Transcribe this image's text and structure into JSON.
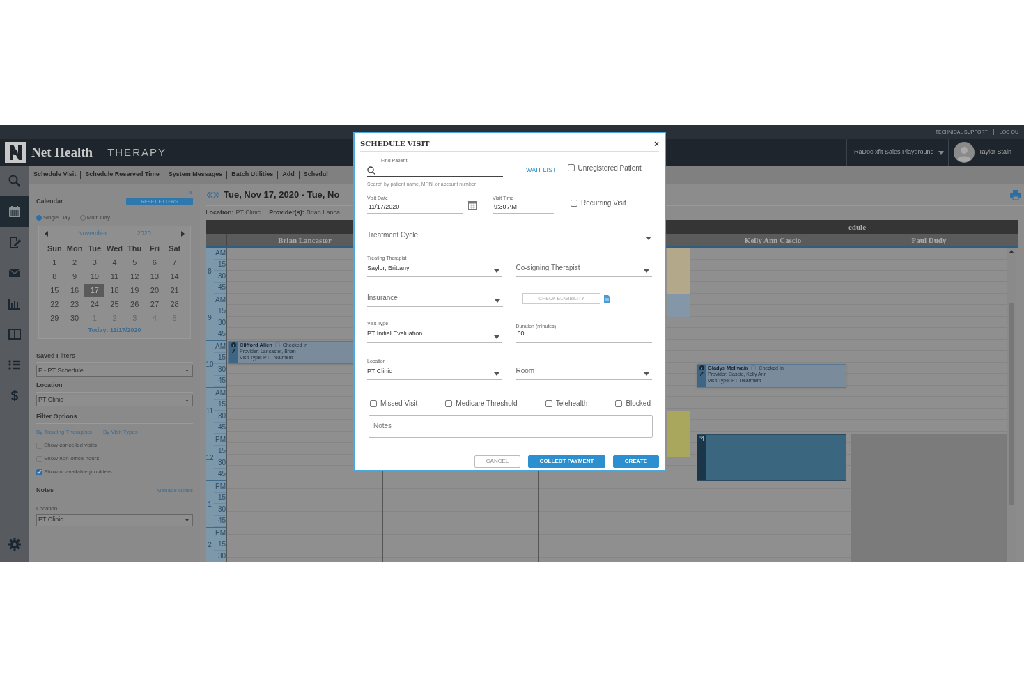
{
  "top_bar": {
    "links": [
      "TECHNICAL SUPPORT",
      "LOG OU"
    ]
  },
  "header": {
    "brand": "Net Health",
    "product": "THERAPY",
    "organization": "RaDoc xfit Sales Playground",
    "user": "Taylor Stain"
  },
  "rail": {
    "items": [
      {
        "kind": "search",
        "selected": false
      },
      {
        "kind": "calendar",
        "selected": true
      },
      {
        "kind": "document",
        "selected": false
      },
      {
        "kind": "mail",
        "selected": false
      },
      {
        "kind": "chart",
        "selected": false
      },
      {
        "kind": "columns",
        "selected": false
      },
      {
        "kind": "list",
        "selected": false
      },
      {
        "kind": "dollar",
        "selected": false
      }
    ],
    "bottom": {
      "kind": "settings",
      "selected": false
    }
  },
  "nav_links": [
    "Schedule Visit",
    "Schedule Reserved Time",
    "System Messages",
    "Batch Utilities",
    "Add",
    "Schedul"
  ],
  "calendar_panel": {
    "title": "Calendar",
    "reset_button": "RESET FILTERS",
    "collapse": "«",
    "modes": [
      {
        "label": "Single Day",
        "selected": true
      },
      {
        "label": "Multi Day",
        "selected": false
      }
    ],
    "month": "November",
    "year": "2020",
    "weekdays": [
      "Sun",
      "Mon",
      "Tue",
      "Wed",
      "Thu",
      "Fri",
      "Sat"
    ],
    "weeks": [
      [
        {
          "day": "1",
          "in_month": true,
          "selected": false
        },
        {
          "day": "2",
          "in_month": true,
          "selected": false
        },
        {
          "day": "3",
          "in_month": true,
          "selected": false
        },
        {
          "day": "4",
          "in_month": true,
          "selected": false
        },
        {
          "day": "5",
          "in_month": true,
          "selected": false
        },
        {
          "day": "6",
          "in_month": true,
          "selected": false
        },
        {
          "day": "7",
          "in_month": true,
          "selected": false
        }
      ],
      [
        {
          "day": "8",
          "in_month": true,
          "selected": false
        },
        {
          "day": "9",
          "in_month": true,
          "selected": false
        },
        {
          "day": "10",
          "in_month": true,
          "selected": false
        },
        {
          "day": "11",
          "in_month": true,
          "selected": false
        },
        {
          "day": "12",
          "in_month": true,
          "selected": false
        },
        {
          "day": "13",
          "in_month": true,
          "selected": false
        },
        {
          "day": "14",
          "in_month": true,
          "selected": false
        }
      ],
      [
        {
          "day": "15",
          "in_month": true,
          "selected": false
        },
        {
          "day": "16",
          "in_month": true,
          "selected": false
        },
        {
          "day": "17",
          "in_month": true,
          "selected": true
        },
        {
          "day": "18",
          "in_month": true,
          "selected": false
        },
        {
          "day": "19",
          "in_month": true,
          "selected": false
        },
        {
          "day": "20",
          "in_month": true,
          "selected": false
        },
        {
          "day": "21",
          "in_month": true,
          "selected": false
        }
      ],
      [
        {
          "day": "22",
          "in_month": true,
          "selected": false
        },
        {
          "day": "23",
          "in_month": true,
          "selected": false
        },
        {
          "day": "24",
          "in_month": true,
          "selected": false
        },
        {
          "day": "25",
          "in_month": true,
          "selected": false
        },
        {
          "day": "26",
          "in_month": true,
          "selected": false
        },
        {
          "day": "27",
          "in_month": true,
          "selected": false
        },
        {
          "day": "28",
          "in_month": true,
          "selected": false
        }
      ],
      [
        {
          "day": "29",
          "in_month": true,
          "selected": false
        },
        {
          "day": "30",
          "in_month": true,
          "selected": false
        },
        {
          "day": "1",
          "in_month": false,
          "selected": false
        },
        {
          "day": "2",
          "in_month": false,
          "selected": false
        },
        {
          "day": "3",
          "in_month": false,
          "selected": false
        },
        {
          "day": "4",
          "in_month": false,
          "selected": false
        },
        {
          "day": "5",
          "in_month": false,
          "selected": false
        }
      ]
    ],
    "today": "Today: 11/17/2020"
  },
  "saved_filters": {
    "label": "Saved Filters",
    "value": "F - PT Schedule"
  },
  "location_filter": {
    "label": "Location",
    "value": "PT Clinic"
  },
  "filter_options": {
    "title": "Filter Options",
    "links": [
      "By Treating Therapists",
      "By Visit Types"
    ],
    "checks": [
      {
        "label": "Show cancelled visits",
        "checked": false
      },
      {
        "label": "Show non-office hours",
        "checked": false
      },
      {
        "label": "Show unavailable providers",
        "checked": true
      }
    ]
  },
  "notes": {
    "title": "Notes",
    "link": "Manage Notes",
    "location_label": "Location",
    "location_value": "PT Clinic"
  },
  "schedule": {
    "title": "Tue, Nov 17, 2020 - Tue, No",
    "location_label": "Location:",
    "location": "PT Clinic",
    "providers_label": "Provider(s):",
    "providers": "Brian Lanca",
    "banner": "edule",
    "hours": [
      {
        "hour": "8",
        "labels": [
          "AM",
          "15",
          "30",
          "45"
        ]
      },
      {
        "hour": "9",
        "labels": [
          "AM",
          "15",
          "30",
          "45"
        ]
      },
      {
        "hour": "10",
        "labels": [
          "AM",
          "15",
          "30",
          "45"
        ]
      },
      {
        "hour": "11",
        "labels": [
          "AM",
          "15",
          "30",
          "45"
        ]
      },
      {
        "hour": "12",
        "labels": [
          "PM",
          "15",
          "30",
          "45"
        ]
      },
      {
        "hour": "1",
        "labels": [
          "PM",
          "15",
          "30",
          "45"
        ]
      },
      {
        "hour": "2",
        "labels": [
          "PM",
          "15",
          "30"
        ]
      }
    ],
    "columns": [
      {
        "name": "Brian Lancaster",
        "appointments": [
          {
            "kind": "visit",
            "patient": "Clifford Allen",
            "checked_in": false,
            "status": "Checked In",
            "provider": "Provider: Lancaster, Brian",
            "visit_type": "Visit Type: PT Treatment"
          }
        ]
      },
      {},
      {
        "appointments": [
          {
            "kind": "block",
            "color": "#b3a98a"
          },
          {
            "kind": "block",
            "color": "#8497a8"
          },
          {
            "kind": "block",
            "color": "#a9a75e"
          }
        ]
      },
      {
        "name": "Kelly Ann Cascio",
        "appointments": [
          {
            "kind": "visit",
            "patient": "Gladys McIlwain",
            "checked_in": false,
            "status": "Checked In",
            "provider": "Provider: Cascio, Kelly Ann",
            "visit_type": "Visit Type: PT Treatment"
          },
          {
            "kind": "block",
            "color": "#3b6680"
          }
        ]
      },
      {
        "name": "Paul Dudy",
        "unavailable_afternoon": true
      }
    ]
  },
  "dialog": {
    "title": "SCHEDULE VISIT",
    "close": "×",
    "find_patient": {
      "label": "Find Patient",
      "hint": "Search by patient name, MRN, or account number"
    },
    "wait_list": "WAIT LIST",
    "unregistered": {
      "label": "Unregistered Patient",
      "checked": false
    },
    "visit_date": {
      "label": "Visit Date",
      "value": "11/17/2020"
    },
    "visit_time": {
      "label": "Visit Time",
      "value": "9:30 AM"
    },
    "recurring": {
      "label": "Recurring Visit",
      "checked": false
    },
    "treatment_cycle": {
      "placeholder": "Treatment Cycle"
    },
    "treating_therapist": {
      "label": "Treating Therapist",
      "value": "Saylor, Brittany"
    },
    "cosigning_therapist": {
      "placeholder": "Co-signing Therapist"
    },
    "insurance": {
      "placeholder": "Insurance"
    },
    "check_eligibility": {
      "label": "CHECK ELIGIBILITY",
      "disabled": true
    },
    "visit_type": {
      "label": "Visit Type",
      "value": "PT Initial Evaluation"
    },
    "duration": {
      "label": "Duration (minutes)",
      "value": "60"
    },
    "location": {
      "label": "Location",
      "value": "PT Clinic"
    },
    "room": {
      "placeholder": "Room"
    },
    "flags": [
      {
        "label": "Missed Visit",
        "checked": false
      },
      {
        "label": "Medicare Threshold",
        "checked": false
      },
      {
        "label": "Telehealth",
        "checked": false
      },
      {
        "label": "Blocked",
        "checked": false
      }
    ],
    "notes": {
      "placeholder": "Notes"
    },
    "buttons": [
      {
        "kind": "secondary",
        "label": "CANCEL"
      },
      {
        "kind": "primary",
        "label": "COLLECT PAYMENT"
      },
      {
        "kind": "primary",
        "label": "CREATE"
      }
    ]
  }
}
